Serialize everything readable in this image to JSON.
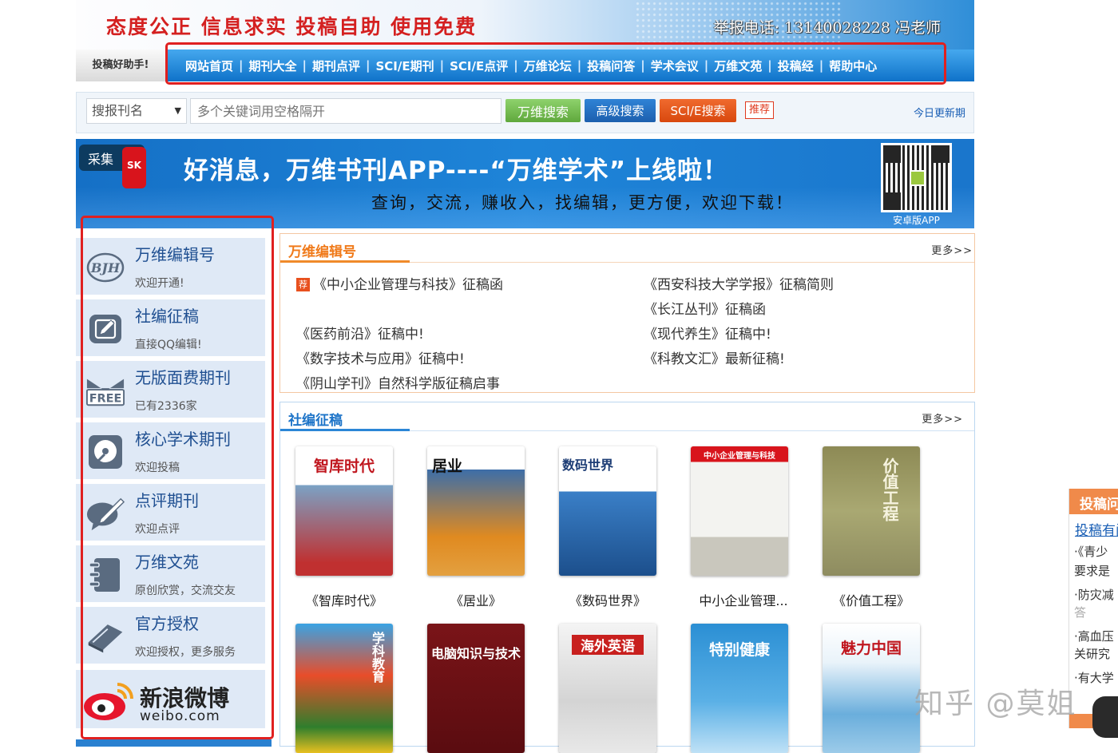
{
  "header": {
    "slogan": "态度公正  信息求实  投稿自助  使用免费",
    "hotline": "举报电话: 13140028228 冯老师"
  },
  "nav": {
    "helper": "投稿好助手!",
    "items": [
      {
        "label": "网站首页"
      },
      {
        "label": "期刊大全"
      },
      {
        "label": "期刊点评"
      },
      {
        "label": "SCI/E期刊"
      },
      {
        "label": "SCI/E点评"
      },
      {
        "label": "万维论坛"
      },
      {
        "label": "投稿问答"
      },
      {
        "label": "学术会议"
      },
      {
        "label": "万维文苑"
      },
      {
        "label": "投稿经"
      },
      {
        "label": "帮助中心"
      }
    ]
  },
  "search": {
    "select_value": "搜报刊名",
    "placeholder": "多个关键词用空格隔开",
    "btn_wanwei": "万维搜索",
    "btn_advanced": "高级搜索",
    "btn_scie": "SCI/E搜索",
    "recommend": "推荐",
    "today_update": "今日更新期"
  },
  "ad": {
    "title": "好消息，万维书刊APP----“万维学术”上线啦！",
    "subtitle": "查询，交流，赚收入，找编辑，更方便，欢迎下载！",
    "qr_label": "安卓版APP",
    "collect_label": "采集",
    "collect_badge": "SK"
  },
  "sidebar": {
    "items": [
      {
        "title": "万维编辑号",
        "sub": "欢迎开通!",
        "icon": "bjh-icon"
      },
      {
        "title": "社编征稿",
        "sub": "直接QQ编辑!",
        "icon": "edit-icon"
      },
      {
        "title": "无版面费期刊",
        "sub": "已有2336家",
        "icon": "free-envelope-icon"
      },
      {
        "title": "核心学术期刊",
        "sub": "欢迎投稿",
        "icon": "disc-icon"
      },
      {
        "title": "点评期刊",
        "sub": "欢迎点评",
        "icon": "comment-pen-icon"
      },
      {
        "title": "万维文苑",
        "sub": "原创欣赏，交流交友",
        "icon": "notebook-icon"
      },
      {
        "title": "官方授权",
        "sub": "欢迎授权，更多服务",
        "icon": "book-icon"
      }
    ],
    "weibo": {
      "text": "新浪微博",
      "url": "weibo.com"
    }
  },
  "editor_panel": {
    "title": "万维编辑号",
    "more": "更多>>",
    "tag": "荐",
    "left_links": [
      "《中小企业管理与科技》征稿函",
      "《医药前沿》征稿中!",
      "《数字技术与应用》征稿中!",
      "《阴山学刊》自然科学版征稿启事"
    ],
    "right_links": [
      "《西安科技大学学报》征稿简则",
      "《长江丛刊》征稿函",
      "《现代养生》征稿中!",
      "《科教文汇》最新征稿!"
    ]
  },
  "society_panel": {
    "title": "社编征稿",
    "more": "更多>>",
    "journals": [
      {
        "caption": "《智库时代》",
        "cover_text": "智库时代"
      },
      {
        "caption": "《居业》",
        "cover_text": "居业"
      },
      {
        "caption": "《数码世界》",
        "cover_text": "数码世界"
      },
      {
        "caption": "中小企业管理...",
        "cover_text": "中小企业管理与科技"
      },
      {
        "caption": "《价值工程》",
        "cover_text": "价值工程"
      }
    ],
    "journals_row2": [
      {
        "cover_text": "学科教育"
      },
      {
        "cover_text": "电脑知识与技术"
      },
      {
        "cover_text": "海外英语"
      },
      {
        "cover_text": "特别健康"
      },
      {
        "cover_text": "魅力中国"
      }
    ]
  },
  "float_panel": {
    "head": "投稿问",
    "link": "投稿有问",
    "items": [
      "·《青少",
      "要求是",
      "·防灾减",
      "答",
      "·高血压",
      "关研究",
      "·有大学"
    ]
  },
  "watermark": "知乎 @莫姐"
}
